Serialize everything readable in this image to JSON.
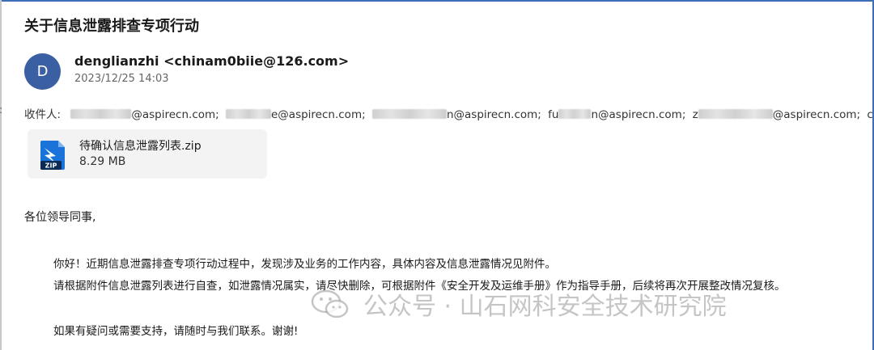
{
  "email": {
    "subject": "关于信息泄露排查专项行动",
    "avatar_initial": "D",
    "sender": "denglianzhi <chinam0biie@126.com>",
    "date": "2023/12/25 14:03",
    "recipients_label": "收件人:",
    "recipients": [
      "@aspirecn.com;",
      "e@aspirecn.com;",
      "n@aspirecn.com;",
      "fu",
      "n@aspirecn.com;",
      "z",
      "@aspirecn.com;",
      "c"
    ],
    "attachment": {
      "name": "待确认信息泄露列表.zip",
      "size": "8.29 MB",
      "icon": "zip-file-icon"
    },
    "greeting": "各位领导同事,",
    "body": [
      "你好！近期信息泄露排查专项行动过程中，发现涉及业务的工作内容，具体内容及信息泄露情况见附件。",
      "请根据附件信息泄露列表进行自查，如泄露情况属实，请尽快删除，可根据附件《安全开发及运维手册》作为指导手册，后续将再次开展整改情况复核。"
    ],
    "closing": "如果有疑问或需要支持，请随时与我们联系。谢谢!"
  },
  "watermark": {
    "text": "公众号 · 山石网科安全技术研究院",
    "icon": "wechat-icon"
  },
  "colors": {
    "avatar": "#3b5fa3",
    "accent_border": "#3b6fb6",
    "attachment_bg": "#f3f3f3"
  }
}
